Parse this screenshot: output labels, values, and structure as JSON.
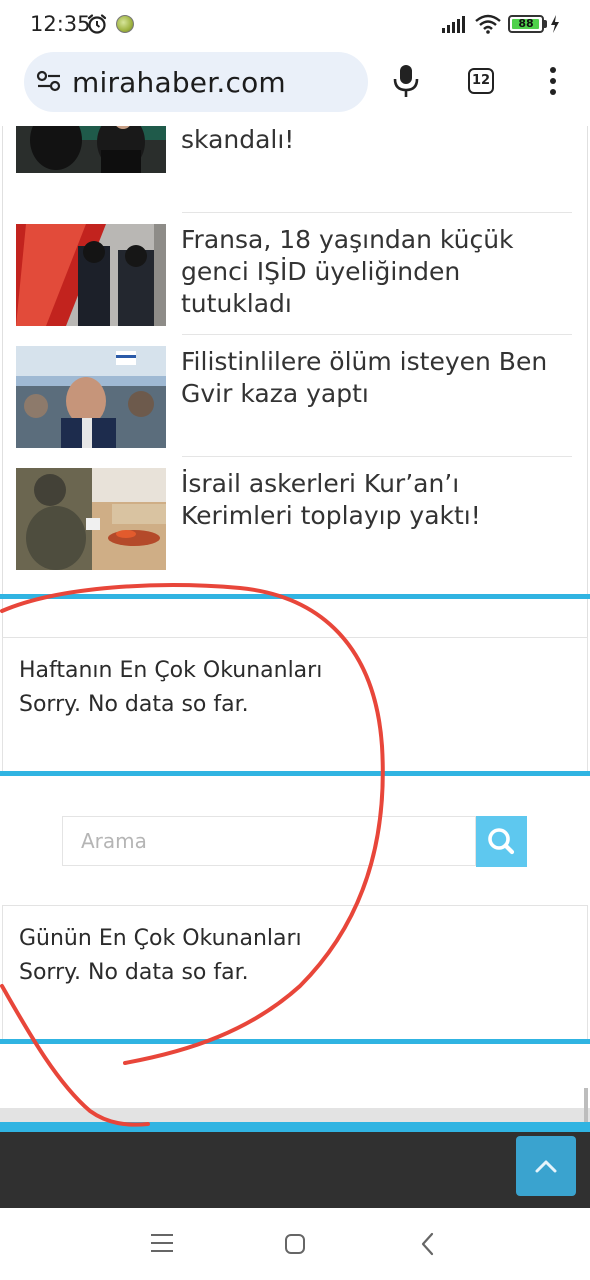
{
  "status_bar": {
    "time": "12:35",
    "battery_level": "88",
    "icons": [
      "alarm-icon",
      "app-notification-icon",
      "signal-icon",
      "wifi-icon",
      "battery-icon",
      "charging-bolt-icon"
    ]
  },
  "browser": {
    "url": "mirahaber.com",
    "tab_count": "12",
    "icons": [
      "site-settings-icon",
      "microphone-icon",
      "tabs-icon",
      "menu-icon"
    ]
  },
  "news_list": {
    "items": [
      {
        "title": "sessiz kalan İran yönetimi skandalı!",
        "visible_title": "skandalı!",
        "thumb": "people-dark-thumbnail"
      },
      {
        "title": "Fransa, 18 yaşından küçük genci IŞİD üyeliğinden tutukladı",
        "thumb": "police-escalator-thumbnail"
      },
      {
        "title": "Filistinlilere ölüm isteyen Ben Gvir kaza yaptı",
        "thumb": "man-in-crowd-thumbnail"
      },
      {
        "title": "İsrail askerleri Kur’an’ı Kerimleri toplayıp yaktı!",
        "thumb": "soldiers-burning-books-thumbnail"
      }
    ]
  },
  "widgets": {
    "weekly": {
      "title": "Haftanın En Çok Okunanları",
      "empty": "Sorry. No data so far."
    },
    "daily": {
      "title": "Günün En Çok Okunanları",
      "empty": "Sorry. No data so far."
    }
  },
  "search": {
    "placeholder": "Arama",
    "value": ""
  },
  "colors": {
    "accent": "#30b4e2",
    "search_button": "#5ec8ef",
    "back_to_top": "#3aa3cf",
    "footer": "#303030",
    "annotation_stroke": "#e8463a"
  },
  "nav": {
    "icons": [
      "recent-apps-icon",
      "home-icon",
      "back-icon"
    ]
  }
}
